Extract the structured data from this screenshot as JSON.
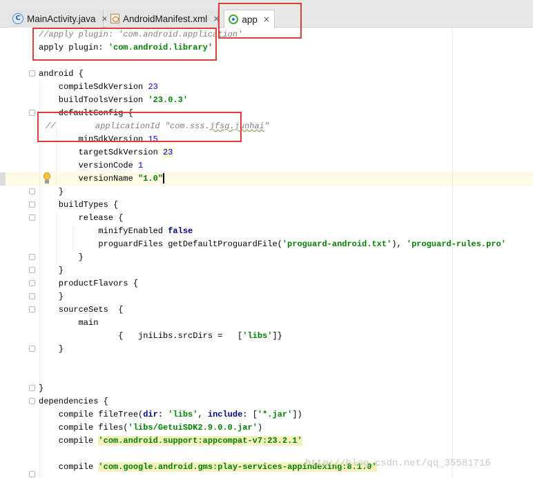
{
  "tabs": [
    {
      "label": "MainActivity.java",
      "icon": "java-class-icon",
      "close": "×",
      "active": false
    },
    {
      "label": "AndroidManifest.xml",
      "icon": "manifest-icon",
      "close": "×",
      "active": false
    },
    {
      "label": "app",
      "icon": "gradle-icon",
      "close": "×",
      "active": true
    }
  ],
  "code": {
    "l1_comment": "//apply plugin: 'com.android.application'",
    "l2_kw": "apply plugin: ",
    "l2_str": "'com.android.library'",
    "l4": "android {",
    "l5_text": "    compileSdkVersion ",
    "l5_num": "23",
    "l6_text": "    buildToolsVersion ",
    "l6_str": "'23.0.3'",
    "l7": "    defaultConfig {",
    "l8_prefix": "//",
    "l8_comment": "        applicationId \"com.sss.",
    "l8_typo": "jfsg.junhai",
    "l8_end": "\"",
    "l9_text": "        minSdkVersion ",
    "l9_num": "15",
    "l10_text": "        targetSdkVersion ",
    "l10_num": "23",
    "l11_text": "        versionCode ",
    "l11_num": "1",
    "l12_text": "        versionName ",
    "l12_str": "\"1.0\"",
    "l13": "    }",
    "l14": "    buildTypes {",
    "l15": "        release {",
    "l16_text": "            minifyEnabled ",
    "l16_kw": "false",
    "l17_text": "            proguardFiles getDefaultProguardFile(",
    "l17_str1": "'proguard-android.txt'",
    "l17_mid": "), ",
    "l17_str2": "'proguard-rules.pro'",
    "l18": "        }",
    "l19": "    }",
    "l20": "    productFlavors {",
    "l21": "    }",
    "l22": "    sourceSets  {",
    "l23": "        main",
    "l24_a": "                {   jniLibs.srcDirs =   [",
    "l24_str": "'libs'",
    "l24_b": "]}",
    "l25": "    }",
    "l28": "}",
    "l29": "dependencies {",
    "l30_a": "    compile fileTree(",
    "l30_kw1": "dir: ",
    "l30_str1": "'libs'",
    "l30_b": ", ",
    "l30_kw2": "include: ",
    "l30_c": "[",
    "l30_str2": "'*.jar'",
    "l30_d": "])",
    "l31_a": "    compile files(",
    "l31_str": "'libs/GetuiSDK2.9.0.0.jar'",
    "l31_b": ")",
    "l32_a": "    compile ",
    "l32_str": "'com.android.support:appcompat-v7:23.2.1'",
    "l34_a": "    compile ",
    "l34_str": "'com.google.android.gms:play-services-appindexing:8.1.0'"
  },
  "watermark": "http://blog.csdn.net/qq_35581716",
  "colors": {
    "keyword": "#000080",
    "string": "#008000",
    "number": "#0000ff",
    "comment": "#808080",
    "annotation_box": "#e53935"
  }
}
